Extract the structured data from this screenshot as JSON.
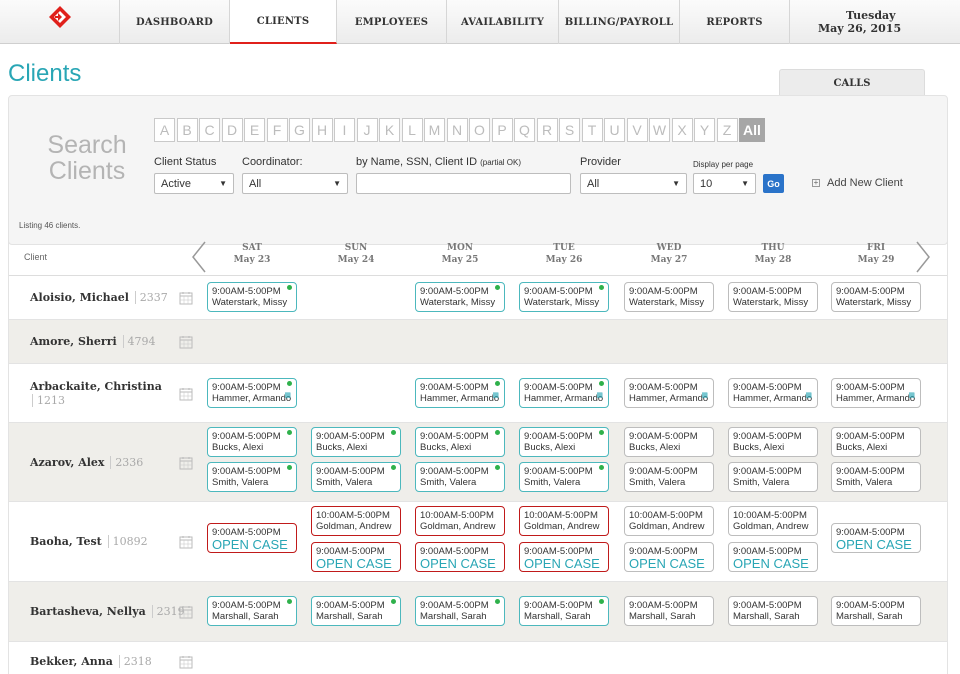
{
  "nav": {
    "items": [
      "DASHBOARD",
      "CLIENTS",
      "EMPLOYEES",
      "AVAILABILITY",
      "BILLING/PAYROLL",
      "REPORTS"
    ],
    "date_day": "Tuesday",
    "date_full": "May 26, 2015"
  },
  "page": {
    "title": "Clients",
    "calls_tab": "CALLS"
  },
  "search": {
    "heading_line1": "Search",
    "heading_line2": "Clients",
    "letters": [
      "A",
      "B",
      "C",
      "D",
      "E",
      "F",
      "G",
      "H",
      "I",
      "J",
      "K",
      "L",
      "M",
      "N",
      "O",
      "P",
      "Q",
      "R",
      "S",
      "T",
      "U",
      "V",
      "W",
      "X",
      "Y",
      "Z",
      "All"
    ],
    "status_label": "Client Status",
    "status_value": "Active",
    "coordinator_label": "Coordinator:",
    "coordinator_value": "All",
    "name_label": "by Name, SSN, Client ID",
    "name_hint": "(partial OK)",
    "provider_label": "Provider",
    "provider_value": "All",
    "display_label": "Display per page",
    "display_value": "10",
    "go_label": "Go",
    "add_client": "Add New Client"
  },
  "listing": "Listing 46 clients.",
  "grid": {
    "client_header": "Client",
    "days": [
      {
        "dow": "SAT",
        "date": "May 23"
      },
      {
        "dow": "SUN",
        "date": "May 24"
      },
      {
        "dow": "MON",
        "date": "May 25"
      },
      {
        "dow": "TUE",
        "date": "May 26"
      },
      {
        "dow": "WED",
        "date": "May 27"
      },
      {
        "dow": "THU",
        "date": "May 28"
      },
      {
        "dow": "FRI",
        "date": "May 29"
      }
    ]
  },
  "clients": [
    {
      "name": "Aloisio, Michael",
      "id": "2337",
      "shifts": [
        [
          0,
          0,
          "9:00AM-5:00PM",
          "Waterstark, Missy",
          "teal",
          true
        ],
        [
          0,
          2,
          "9:00AM-5:00PM",
          "Waterstark, Missy",
          "teal",
          true
        ],
        [
          0,
          3,
          "9:00AM-5:00PM",
          "Waterstark, Missy",
          "teal",
          true
        ],
        [
          0,
          4,
          "9:00AM-5:00PM",
          "Waterstark, Missy",
          "gray",
          false
        ],
        [
          0,
          5,
          "9:00AM-5:00PM",
          "Waterstark, Missy",
          "gray",
          false
        ],
        [
          0,
          6,
          "9:00AM-5:00PM",
          "Waterstark, Missy",
          "gray",
          false
        ]
      ]
    },
    {
      "name": "Amore, Sherri",
      "id": "4794",
      "shifts": []
    },
    {
      "name": "Arbackaite, Christina",
      "id": "1213",
      "shifts": [
        [
          0,
          0,
          "9:00AM-5:00PM",
          "Hammer, Armando",
          "teal",
          true
        ],
        [
          0,
          2,
          "9:00AM-5:00PM",
          "Hammer, Armando",
          "teal",
          true
        ],
        [
          0,
          3,
          "9:00AM-5:00PM",
          "Hammer, Armando",
          "teal",
          true
        ],
        [
          0,
          4,
          "9:00AM-5:00PM",
          "Hammer, Armando",
          "gray",
          false
        ],
        [
          0,
          5,
          "9:00AM-5:00PM",
          "Hammer, Armando",
          "gray",
          false
        ],
        [
          0,
          6,
          "9:00AM-5:00PM",
          "Hammer, Armando",
          "gray",
          false
        ]
      ]
    },
    {
      "name": "Azarov, Alex",
      "id": "2336",
      "shifts": [
        [
          0,
          0,
          "9:00AM-5:00PM",
          "Bucks, Alexi",
          "teal",
          true
        ],
        [
          0,
          1,
          "9:00AM-5:00PM",
          "Bucks, Alexi",
          "teal",
          true
        ],
        [
          0,
          2,
          "9:00AM-5:00PM",
          "Bucks, Alexi",
          "teal",
          true
        ],
        [
          0,
          3,
          "9:00AM-5:00PM",
          "Bucks, Alexi",
          "teal",
          true
        ],
        [
          0,
          4,
          "9:00AM-5:00PM",
          "Bucks, Alexi",
          "gray",
          false
        ],
        [
          0,
          5,
          "9:00AM-5:00PM",
          "Bucks, Alexi",
          "gray",
          false
        ],
        [
          0,
          6,
          "9:00AM-5:00PM",
          "Bucks, Alexi",
          "gray",
          false
        ],
        [
          1,
          0,
          "9:00AM-5:00PM",
          "Smith, Valera",
          "teal",
          true
        ],
        [
          1,
          1,
          "9:00AM-5:00PM",
          "Smith, Valera",
          "teal",
          true
        ],
        [
          1,
          2,
          "9:00AM-5:00PM",
          "Smith, Valera",
          "teal",
          true
        ],
        [
          1,
          3,
          "9:00AM-5:00PM",
          "Smith, Valera",
          "teal",
          true
        ],
        [
          1,
          4,
          "9:00AM-5:00PM",
          "Smith, Valera",
          "gray",
          false
        ],
        [
          1,
          5,
          "9:00AM-5:00PM",
          "Smith, Valera",
          "gray",
          false
        ],
        [
          1,
          6,
          "9:00AM-5:00PM",
          "Smith, Valera",
          "gray",
          false
        ]
      ]
    },
    {
      "name": "Baoha, Test",
      "id": "10892",
      "shifts": [
        [
          0,
          1,
          "10:00AM-5:00PM",
          "Goldman, Andrew",
          "red",
          false
        ],
        [
          0,
          2,
          "10:00AM-5:00PM",
          "Goldman, Andrew",
          "red",
          false
        ],
        [
          0,
          3,
          "10:00AM-5:00PM",
          "Goldman, Andrew",
          "red",
          false
        ],
        [
          0,
          4,
          "10:00AM-5:00PM",
          "Goldman, Andrew",
          "gray",
          false
        ],
        [
          0,
          5,
          "10:00AM-5:00PM",
          "Goldman, Andrew",
          "gray",
          false
        ],
        [
          1,
          1,
          "9:00AM-5:00PM",
          "OPEN CASE",
          "red",
          false
        ],
        [
          1,
          2,
          "9:00AM-5:00PM",
          "OPEN CASE",
          "red",
          false
        ],
        [
          1,
          3,
          "9:00AM-5:00PM",
          "OPEN CASE",
          "red",
          false
        ],
        [
          1,
          4,
          "9:00AM-5:00PM",
          "OPEN CASE",
          "gray",
          false
        ],
        [
          1,
          5,
          "9:00AM-5:00PM",
          "OPEN CASE",
          "gray",
          false
        ],
        [
          9,
          0,
          "9:00AM-5:00PM",
          "OPEN CASE",
          "red",
          false
        ],
        [
          9,
          6,
          "9:00AM-5:00PM",
          "OPEN CASE",
          "gray",
          false
        ]
      ]
    },
    {
      "name": "Bartasheva, Nellya",
      "id": "2319",
      "shifts": [
        [
          0,
          0,
          "9:00AM-5:00PM",
          "Marshall, Sarah",
          "teal",
          true
        ],
        [
          0,
          1,
          "9:00AM-5:00PM",
          "Marshall, Sarah",
          "teal",
          true
        ],
        [
          0,
          2,
          "9:00AM-5:00PM",
          "Marshall, Sarah",
          "teal",
          true
        ],
        [
          0,
          3,
          "9:00AM-5:00PM",
          "Marshall, Sarah",
          "teal",
          true
        ],
        [
          0,
          4,
          "9:00AM-5:00PM",
          "Marshall, Sarah",
          "gray",
          false
        ],
        [
          0,
          5,
          "9:00AM-5:00PM",
          "Marshall, Sarah",
          "gray",
          false
        ],
        [
          0,
          6,
          "9:00AM-5:00PM",
          "Marshall, Sarah",
          "gray",
          false
        ]
      ]
    },
    {
      "name": "Bekker, Anna",
      "id": "2318",
      "shifts": []
    }
  ]
}
